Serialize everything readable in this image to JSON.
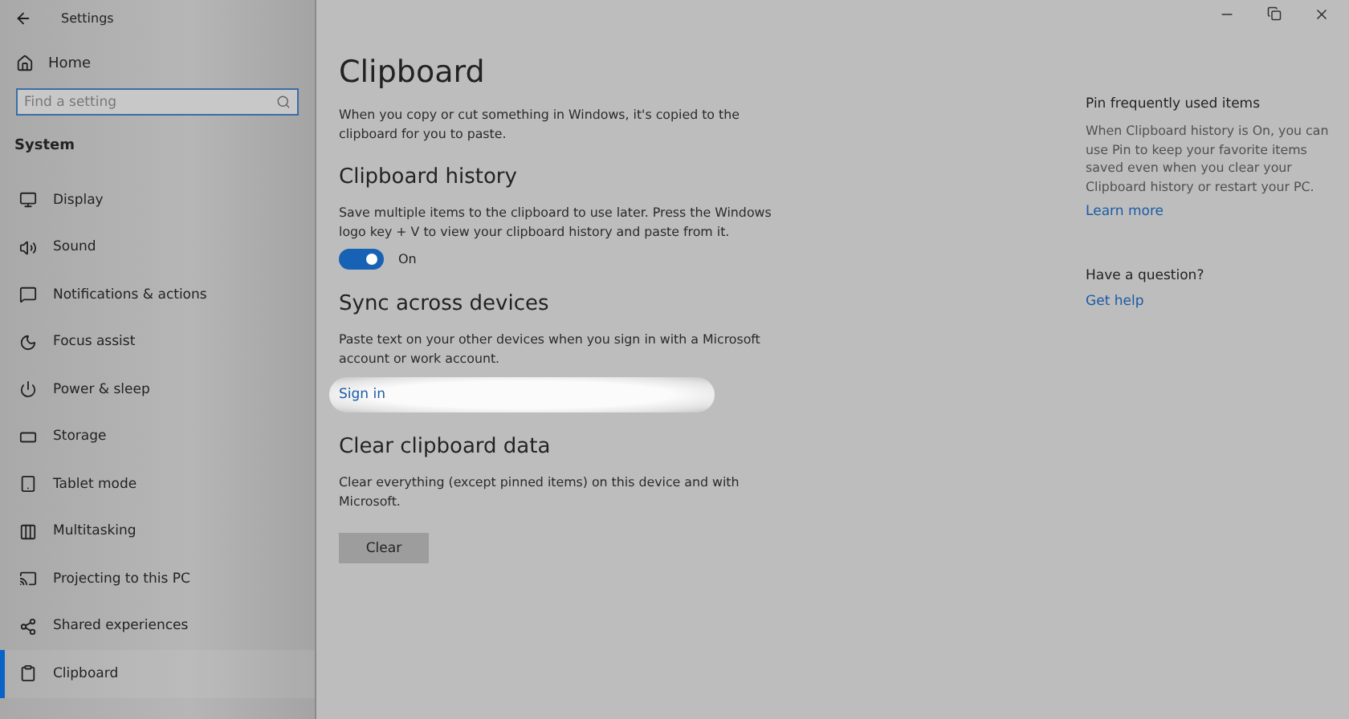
{
  "window": {
    "title": "Settings"
  },
  "sidebar": {
    "home": "Home",
    "search": {
      "placeholder": "Find a setting"
    },
    "section": "System",
    "items": [
      {
        "label": "Display",
        "selected": false
      },
      {
        "label": "Sound",
        "selected": false
      },
      {
        "label": "Notifications & actions",
        "selected": false
      },
      {
        "label": "Focus assist",
        "selected": false
      },
      {
        "label": "Power & sleep",
        "selected": false
      },
      {
        "label": "Storage",
        "selected": false
      },
      {
        "label": "Tablet mode",
        "selected": false
      },
      {
        "label": "Multitasking",
        "selected": false
      },
      {
        "label": "Projecting to this PC",
        "selected": false
      },
      {
        "label": "Shared experiences",
        "selected": false
      },
      {
        "label": "Clipboard",
        "selected": true
      }
    ]
  },
  "main": {
    "title": "Clipboard",
    "intro": "When you copy or cut something in Windows, it's copied to the clipboard for you to paste.",
    "sections": [
      {
        "kind": "toggle",
        "heading": "Clipboard history",
        "text": "Save multiple items to the clipboard to use later. Press the Windows logo key + V to view your clipboard history and paste from it.",
        "on": true,
        "state_label": "On"
      },
      {
        "kind": "link",
        "heading": "Sync across devices",
        "text": "Paste text on your other devices when you sign in with a Microsoft account or work account.",
        "link": "Sign in",
        "highlighted": true
      },
      {
        "kind": "button",
        "heading": "Clear clipboard data",
        "text": "Clear everything (except pinned items) on this device and with Microsoft.",
        "button": "Clear"
      }
    ]
  },
  "aside": {
    "heading": "Pin frequently used items",
    "text": "When Clipboard history is On, you can use Pin to keep your favorite items saved even when you clear your Clipboard history or restart your PC.",
    "link": "Learn more",
    "question": "Have a question?",
    "help": "Get help"
  }
}
